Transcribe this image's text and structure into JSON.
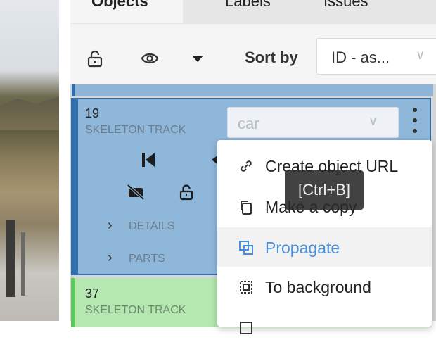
{
  "tabs": [
    {
      "label": "Objects",
      "active": true
    },
    {
      "label": "Labels",
      "active": false
    },
    {
      "label": "Issues",
      "active": false
    }
  ],
  "toolbar": {
    "icons": [
      "lock-icon",
      "eye-icon",
      "caret-down-icon"
    ],
    "sort_label": "Sort by",
    "sort_value": "ID - as...",
    "sort_chevron": "∨"
  },
  "objects": [
    {
      "id": "19",
      "type": "SKELETON TRACK",
      "label": "car",
      "label_chevron": "∨",
      "color": "#8fb7da",
      "details_label": "DETAILS",
      "parts_label": "PARTS"
    },
    {
      "id": "37",
      "type": "SKELETON TRACK",
      "color": "#b5e7b0"
    }
  ],
  "context_menu": {
    "items": [
      {
        "label": "Create object URL",
        "icon": "link-icon"
      },
      {
        "label": "Make a copy",
        "icon": "copy-icon"
      },
      {
        "label": "Propagate",
        "icon": "propagate-icon",
        "highlighted": true
      },
      {
        "label": "To background",
        "icon": "to-background-icon"
      }
    ]
  },
  "tooltip": {
    "text": "[Ctrl+B]"
  },
  "colors": {
    "accent": "#4a90d9",
    "selected_card": "#8fb7da",
    "green_card": "#b5e7b0"
  }
}
